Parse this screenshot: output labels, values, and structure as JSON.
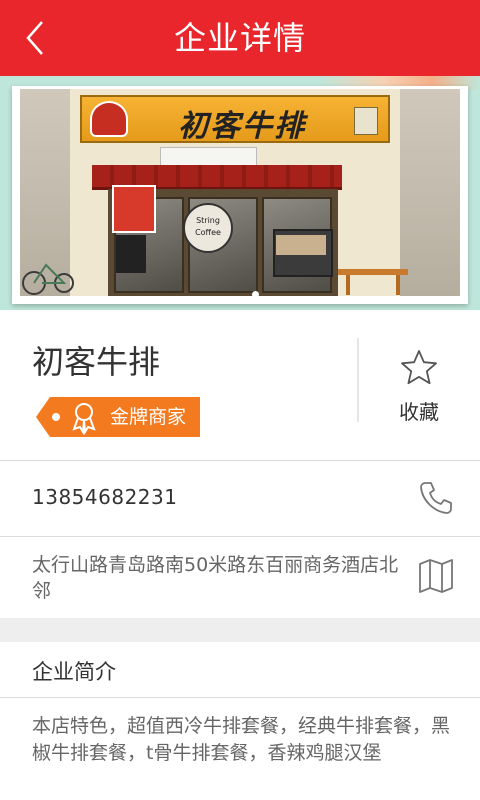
{
  "header": {
    "title": "企业详情",
    "back_icon": "chevron-left-icon",
    "background": "#e8262c"
  },
  "banner": {
    "sign_text": "初客牛排",
    "cafe_sign_text": "String Coffee",
    "indicator_count": 1
  },
  "company": {
    "name": "初客牛排",
    "badge_label": "金牌商家",
    "badge_color": "#f47a1f",
    "favorite_label": "收藏"
  },
  "contact": {
    "phone": "13854682231",
    "address": "太行山路青岛路南50米路东百丽商务酒店北邻"
  },
  "intro": {
    "title": "企业简介",
    "text": "本店特色，超值西冷牛排套餐，经典牛排套餐，黑椒牛排套餐，t骨牛排套餐，香辣鸡腿汉堡"
  }
}
